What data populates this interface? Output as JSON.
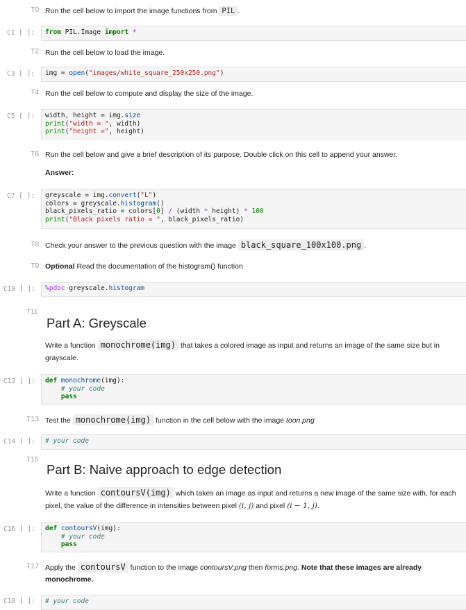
{
  "t0": {
    "tag": "T0",
    "a": "Run the cell below to import the image functions from",
    "mono": "PIL",
    "b": "."
  },
  "c1": {
    "tag": "C1 [ ]:",
    "kw1": "from",
    "mod": "PIL.Image",
    "kw2": "import",
    "star": "*"
  },
  "t2": {
    "tag": "T2",
    "text": "Run the cell below to load the image."
  },
  "c3": {
    "tag": "C3 [ ]:",
    "a": "img = ",
    "fn": "open",
    "p1": "(",
    "str": "\"images/white_square_250x250.png\"",
    "p2": ")"
  },
  "t4": {
    "tag": "T4",
    "text": "Run the cell below to compute and display the size of the image."
  },
  "c5": {
    "tag": "C5 [ ]:",
    "l1a": "width, height = img.",
    "l1b": "size",
    "l2a": "print",
    "l2b": "(",
    "l2c": "\"width = \"",
    "l2d": ", width)",
    "l3a": "print",
    "l3b": "(",
    "l3c": "\"height =\"",
    "l3d": ", height)"
  },
  "t6": {
    "tag": "T6",
    "text": "Run the cell below and give a brief description of its purpose. Double click on this cell to append your answer.",
    "answer": "Answer:"
  },
  "c7": {
    "tag": "C7 [ ]:",
    "l1a": "greyscale = img.",
    "l1b": "convert",
    "l1c": "(",
    "l1d": "\"L\"",
    "l1e": ")",
    "l2a": "colors = greyscale.",
    "l2b": "histogram",
    "l2c": "()",
    "l3a": "black_pixels_ratio = colors[",
    "l3b": "0",
    "l3c": "] ",
    "l3d": "/",
    "l3e": " (width ",
    "l3f": "*",
    "l3g": " height) ",
    "l3h": "*",
    "l3i": " ",
    "l3j": "100",
    "l4a": "print",
    "l4b": "(",
    "l4c": "\"Black pixels ratio = \"",
    "l4d": ", black_pixels_ratio)"
  },
  "t8": {
    "tag": "T8",
    "a": "Check your answer to the previous question with the image",
    "mono": "black_square_100x100.png",
    "b": "."
  },
  "t9": {
    "tag": "T9",
    "bold": "Optional",
    "text": " Read the documentation of the histogram() function"
  },
  "c10": {
    "tag": "C10 [ ]:",
    "magic": "%pdoc",
    "a": " greyscale.",
    "b": "histogram"
  },
  "t11": {
    "tag": "T11",
    "title": "Part A: Greyscale",
    "a": "Write a function",
    "mono": "monochrome(img)",
    "b": "that takes a colored image as input and returns an image of the same size but in",
    "c": "grayscale."
  },
  "c12": {
    "tag": "C12 [ ]:",
    "kw": "def",
    "fn": "monochrome",
    "args": "(img):",
    "cm": "# your code",
    "pass": "pass"
  },
  "t13": {
    "tag": "T13",
    "a": "Test the",
    "mono": "monochrome(img)",
    "b": "function in the cell below with the image",
    "it": "toon.png"
  },
  "c14": {
    "tag": "C14 [ ]:",
    "cm": "# your code"
  },
  "t15": {
    "tag": "T15",
    "title": "Part B: Naive approach to edge detection",
    "a": "Write a function",
    "mono": "contoursV(img)",
    "b": "which takes an image as input and returns a new image of the same size with, for each",
    "c": "pixel, the value of the difference in intensities between pixel",
    "m1": "(i, j)",
    "d": "and pixel",
    "m2": "(i − 1, j)",
    "e": "."
  },
  "c16": {
    "tag": "C16 [ ]:",
    "kw": "def",
    "fn": "contoursV",
    "args": "(img):",
    "cm": "# your code",
    "pass": "pass"
  },
  "t17": {
    "tag": "T17",
    "a": "Apply the",
    "mono": "contoursV",
    "b": "function to the image",
    "it1": "contoursV.png",
    "c": "then",
    "it2": "forms.png",
    "d": ".",
    "bold1": "Note that these images are already",
    "bold2": "monochrome."
  },
  "c18": {
    "tag": "C18 [ ]:",
    "cm": "# your code"
  }
}
